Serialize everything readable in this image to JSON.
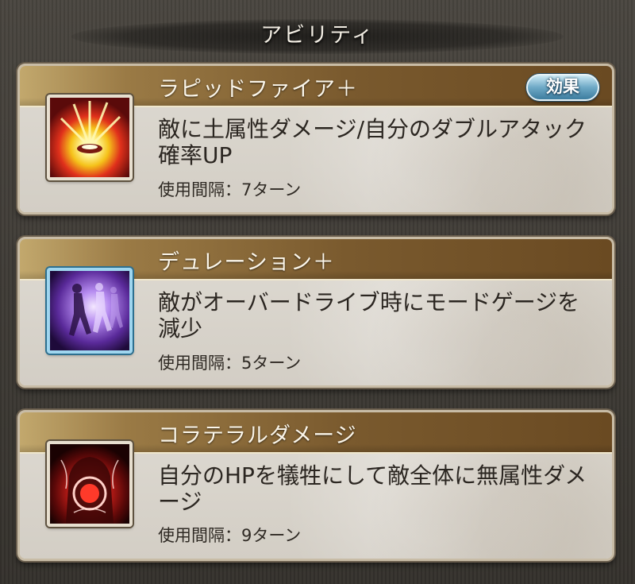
{
  "header": {
    "title": "アビリティ"
  },
  "abilities": [
    {
      "name": "ラピッドファイア＋",
      "description": "敵に土属性ダメージ/自分のダブルアタック確率UP",
      "cooldown": "使用間隔：7ターン",
      "icon": "explosion-icon",
      "effect_label": "効果"
    },
    {
      "name": "デュレーション＋",
      "description": "敵がオーバードライブ時にモードゲージを減少",
      "cooldown": "使用間隔：5ターン",
      "icon": "dancing-figures-icon"
    },
    {
      "name": "コラテラルダメージ",
      "description": "自分のHPを犠牲にして敵全体に無属性ダメージ",
      "cooldown": "使用間隔：9ターン",
      "icon": "red-aura-body-icon"
    }
  ],
  "colors": {
    "banner": "#7a5a2e",
    "effect_button": "#3d7d9f",
    "card": "#d9d5cd"
  }
}
